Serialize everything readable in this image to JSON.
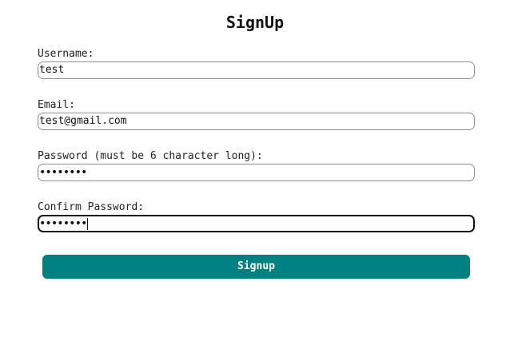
{
  "form": {
    "title": "SignUp",
    "fields": [
      {
        "label": "Username:",
        "value": "test"
      },
      {
        "label": "Email:",
        "value": "test@gmail.com"
      },
      {
        "label": "Password (must be 6 character long):",
        "value": "••••••••"
      },
      {
        "label": "Confirm Password:",
        "value": "••••••••"
      }
    ],
    "submit_label": "Signup"
  },
  "colors": {
    "button_background": "#008080",
    "button_text": "#ffffff",
    "input_border": "#8f8f8f",
    "focused_border": "#111111"
  }
}
